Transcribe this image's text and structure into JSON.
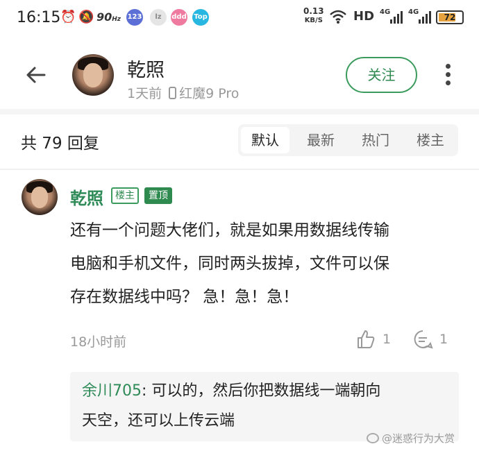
{
  "status_bar": {
    "time": "16:15",
    "refresh_rate": "90",
    "refresh_rate_unit": "Hz",
    "badges": [
      "123",
      "lz",
      "ddd",
      "Top"
    ],
    "net_speed": "0.13",
    "net_speed_unit": "KB/S",
    "hd_label": "HD",
    "signal1": "4G",
    "signal2": "4G",
    "battery": "72"
  },
  "header": {
    "name": "乾照",
    "time_ago": "1天前",
    "device": "红魔9 Pro",
    "follow_label": "关注"
  },
  "replies": {
    "count_label": "共 79 回复",
    "sort_tabs": [
      {
        "label": "默认",
        "active": true
      },
      {
        "label": "最新",
        "active": false
      },
      {
        "label": "热门",
        "active": false
      },
      {
        "label": "楼主",
        "active": false
      }
    ]
  },
  "comment": {
    "author": "乾照",
    "tag_owner": "楼主",
    "tag_pinned": "置顶",
    "lines": [
      "还有一个问题大佬们，就是如果用数据线传输",
      "电脑和手机文件，同时两头拔掉，文件可以保",
      "存在数据线中吗？ 急！急！急！"
    ],
    "time": "18小时前",
    "likes": "1",
    "comments": "1",
    "sub_reply": {
      "author": "余川705",
      "separator": ": ",
      "text_line1": "可以的，然后你把数据线一端朝向",
      "text_line2": "天空，还可以上传云端"
    }
  },
  "watermark": "@迷惑行为大赏",
  "colors": {
    "accent_green": "#2e8b57",
    "muted": "#999999",
    "battery_fill": "#e6a23c"
  }
}
